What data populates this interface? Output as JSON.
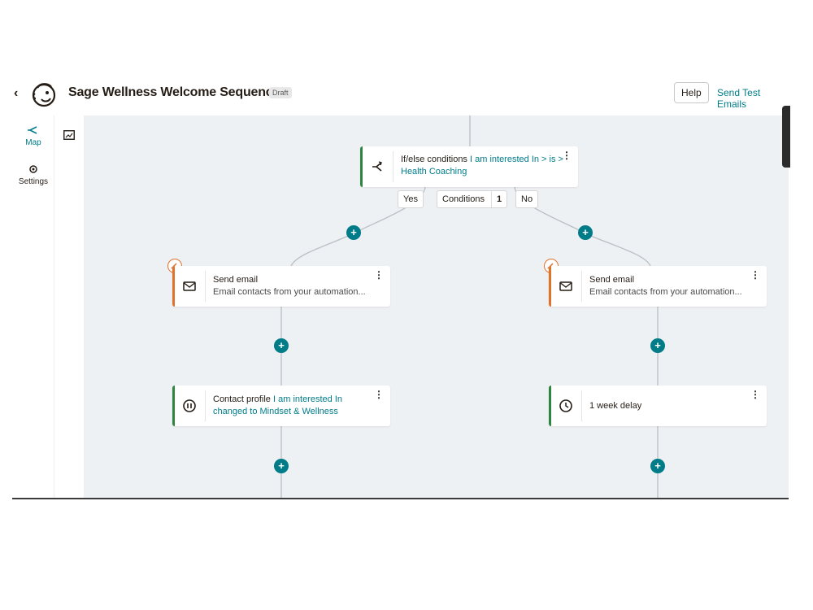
{
  "header": {
    "back_icon": "chevron-left-icon",
    "back_glyph": "‹",
    "logo": "mailchimp-freddie-logo",
    "title": "Sage Wellness Welcome Sequence",
    "status_badge": "Draft",
    "help_label": "Help",
    "send_test_label": "Send Test Emails"
  },
  "leftnav": {
    "items": [
      {
        "label": "Map",
        "icon": "flow-map-icon",
        "active": true
      },
      {
        "label": "Settings",
        "icon": "gear-icon",
        "active": false
      }
    ],
    "subnav_icon": "image-icon"
  },
  "flow": {
    "condition": {
      "icon": "branch-icon",
      "label": "If/else conditions",
      "link1": "I am interested In > is >",
      "link2": "Health Coaching"
    },
    "yes_label": "Yes",
    "no_label": "No",
    "conditions_label": "Conditions",
    "conditions_count": "1",
    "left_email": {
      "icon": "envelope-icon",
      "title": "Send email",
      "subtitle": "Email contacts from your automation..."
    },
    "right_email": {
      "icon": "envelope-icon",
      "title": "Send email",
      "subtitle": "Email contacts from your automation..."
    },
    "left_profile": {
      "icon": "pause-icon",
      "label": "Contact profile",
      "link1": "I am interested In",
      "link2": "changed to Mindset & Wellness"
    },
    "right_delay": {
      "icon": "clock-icon",
      "label": "1 week delay"
    },
    "plus_glyph": "+",
    "kebab_glyph": "⋮"
  },
  "colors": {
    "accent": "#007c89",
    "green_bar": "#2e8540",
    "orange_bar": "#e0732c",
    "canvas_bg": "#eef1f4"
  }
}
